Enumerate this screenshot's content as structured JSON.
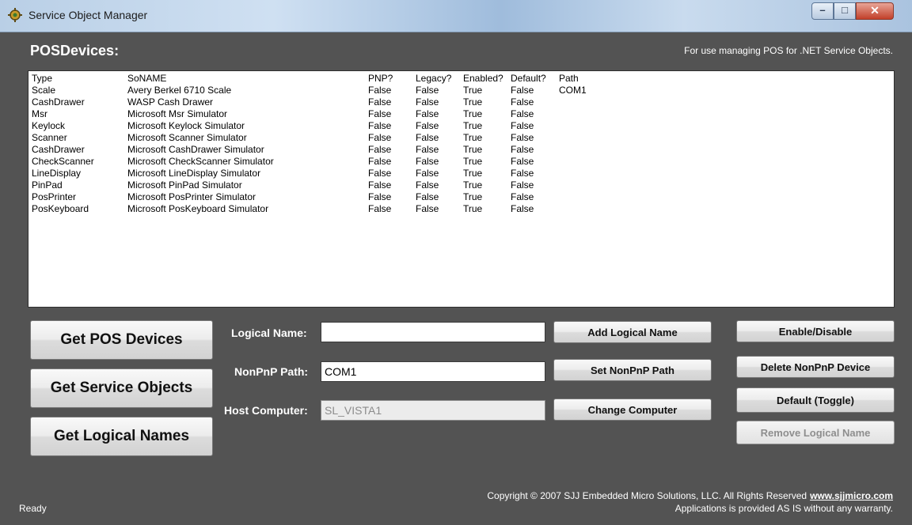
{
  "window": {
    "title": "Service Object Manager"
  },
  "header": {
    "title": "POSDevices:",
    "note": "For use managing POS for .NET Service Objects."
  },
  "table": {
    "headers": [
      "Type",
      "SoNAME",
      "PNP?",
      "Legacy?",
      "Enabled?",
      "Default?",
      "Path"
    ],
    "rows": [
      [
        "Scale",
        "Avery Berkel 6710 Scale",
        "False",
        "False",
        "True",
        "False",
        "COM1"
      ],
      [
        "CashDrawer",
        "WASP Cash Drawer",
        "False",
        "False",
        "True",
        "False",
        ""
      ],
      [
        "Msr",
        "Microsoft Msr Simulator",
        "False",
        "False",
        "True",
        "False",
        ""
      ],
      [
        "Keylock",
        "Microsoft Keylock Simulator",
        "False",
        "False",
        "True",
        "False",
        ""
      ],
      [
        "Scanner",
        "Microsoft Scanner Simulator",
        "False",
        "False",
        "True",
        "False",
        ""
      ],
      [
        "CashDrawer",
        "Microsoft CashDrawer Simulator",
        "False",
        "False",
        "True",
        "False",
        ""
      ],
      [
        "CheckScanner",
        "Microsoft CheckScanner Simulator",
        "False",
        "False",
        "True",
        "False",
        ""
      ],
      [
        "LineDisplay",
        "Microsoft LineDisplay Simulator",
        "False",
        "False",
        "True",
        "False",
        ""
      ],
      [
        "PinPad",
        "Microsoft PinPad Simulator",
        "False",
        "False",
        "True",
        "False",
        ""
      ],
      [
        "PosPrinter",
        "Microsoft PosPrinter Simulator",
        "False",
        "False",
        "True",
        "False",
        ""
      ],
      [
        "PosKeyboard",
        "Microsoft PosKeyboard Simulator",
        "False",
        "False",
        "True",
        "False",
        ""
      ]
    ]
  },
  "buttons": {
    "get_pos_devices": "Get POS Devices",
    "get_service_objects": "Get Service Objects",
    "get_logical_names": "Get Logical Names",
    "add_logical_name": "Add Logical Name",
    "set_nonpnp_path": "Set NonPnP Path",
    "change_computer": "Change Computer",
    "enable_disable": "Enable/Disable",
    "delete_nonpnp_device": "Delete NonPnP Device",
    "default_toggle": "Default (Toggle)",
    "remove_logical_name": "Remove Logical Name"
  },
  "form": {
    "logical_name_label": "Logical Name:",
    "logical_name_value": "",
    "nonpnp_path_label": "NonPnP Path:",
    "nonpnp_path_value": "COM1",
    "host_computer_label": "Host Computer:",
    "host_computer_value": "SL_VISTA1"
  },
  "status": "Ready",
  "footer": {
    "copyright": "Copyright © 2007 SJJ Embedded Micro Solutions, LLC. All Rights Reserved",
    "link": "www.sjjmicro.com",
    "disclaimer": "Applications is provided AS IS without any warranty."
  },
  "icons": {
    "app": "gear-icon",
    "minimize": "minimize-icon",
    "maximize": "maximize-icon",
    "close": "close-icon"
  }
}
